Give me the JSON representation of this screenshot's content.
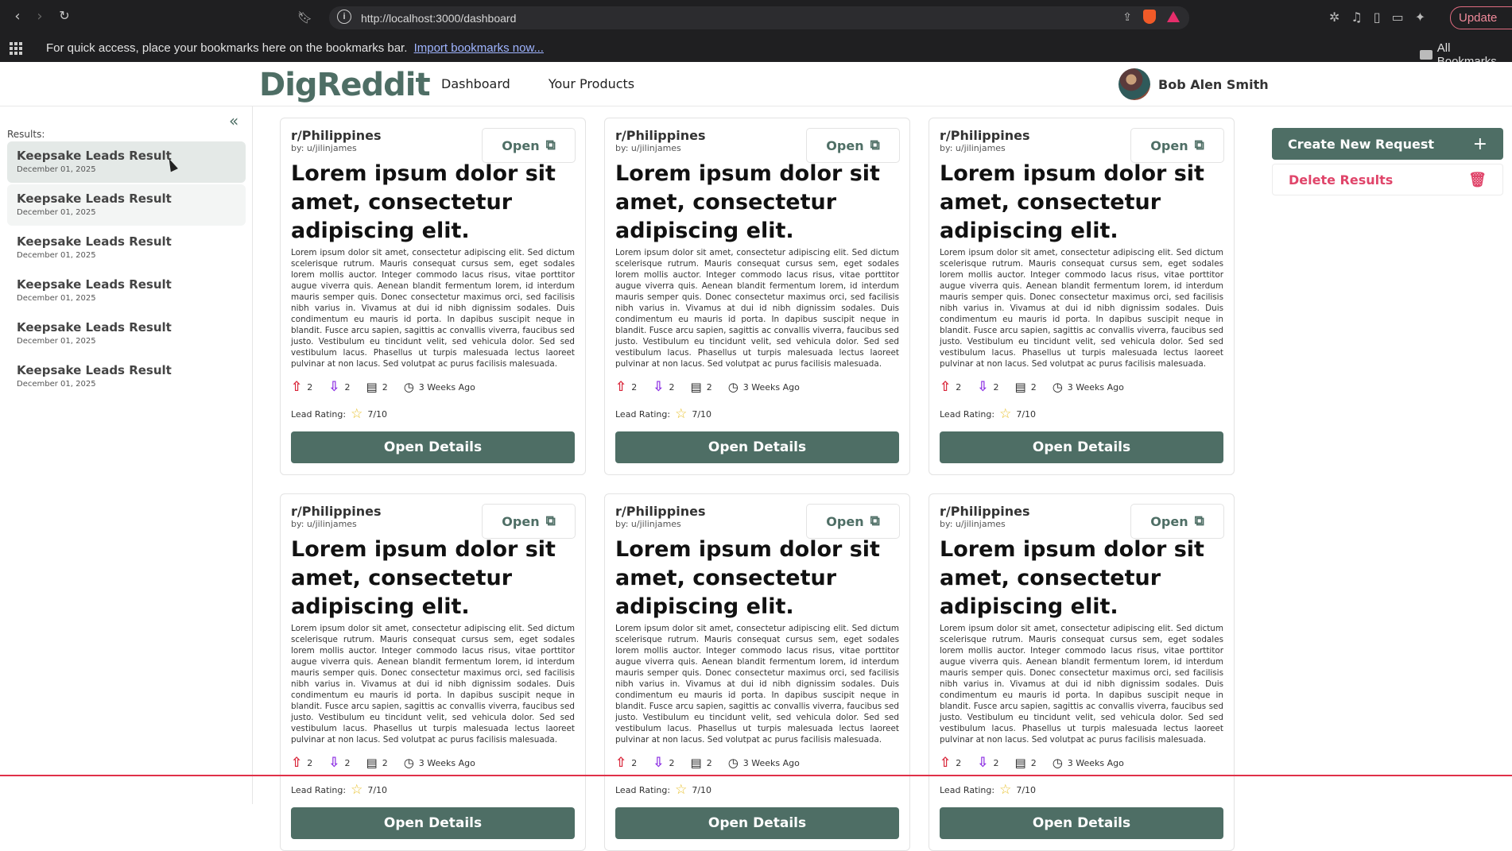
{
  "browser": {
    "url": "http://localhost:3000/dashboard",
    "bookmarks_prompt": "For quick access, place your bookmarks here on the bookmarks bar.",
    "import_link": "Import bookmarks now...",
    "all_bookmarks": "All Bookmarks",
    "update_label": "Update"
  },
  "app": {
    "logo": "DigReddit",
    "nav": [
      "Dashboard",
      "Your Products"
    ],
    "user_name": "Bob Alen Smith"
  },
  "sidebar": {
    "results_label": "Results:",
    "items": [
      {
        "title": "Keepsake Leads Result",
        "date": "December 01, 2025"
      },
      {
        "title": "Keepsake Leads Result",
        "date": "December 01, 2025"
      },
      {
        "title": "Keepsake Leads Result",
        "date": "December 01, 2025"
      },
      {
        "title": "Keepsake Leads Result",
        "date": "December 01, 2025"
      },
      {
        "title": "Keepsake Leads Result",
        "date": "December 01, 2025"
      },
      {
        "title": "Keepsake Leads Result",
        "date": "December 01, 2025"
      }
    ]
  },
  "actions": {
    "create": "Create New Request",
    "delete": "Delete Results"
  },
  "card": {
    "subreddit": "r/Philippines",
    "author": "by: u/jilinjames",
    "open_label": "Open",
    "title": "Lorem ipsum dolor sit amet, consectetur adipiscing elit.",
    "body": "Lorem ipsum dolor sit amet, consectetur adipiscing elit. Sed dictum scelerisque rutrum. Mauris consequat cursus sem, eget sodales lorem mollis auctor. Integer commodo lacus risus, vitae porttitor augue viverra quis. Aenean blandit fermentum lorem, id interdum mauris semper quis. Donec consectetur maximus orci, sed facilisis nibh varius in. Vivamus at dui id nibh dignissim sodales. Duis condimentum eu mauris id porta. In dapibus suscipit neque in blandit. Fusce arcu sapien, sagittis ac convallis viverra, faucibus sed justo. Vestibulum eu tincidunt velit, sed vehicula dolor. Sed sed vestibulum lacus. Phasellus ut turpis malesuada lectus laoreet pulvinar at non lacus. Sed volutpat ac purus facilisis malesuada.",
    "upvotes": "2",
    "downvotes": "2",
    "comments": "2",
    "time": "3 Weeks Ago",
    "rating_label": "Lead Rating:",
    "rating": "7/10",
    "details_label": "Open Details"
  }
}
